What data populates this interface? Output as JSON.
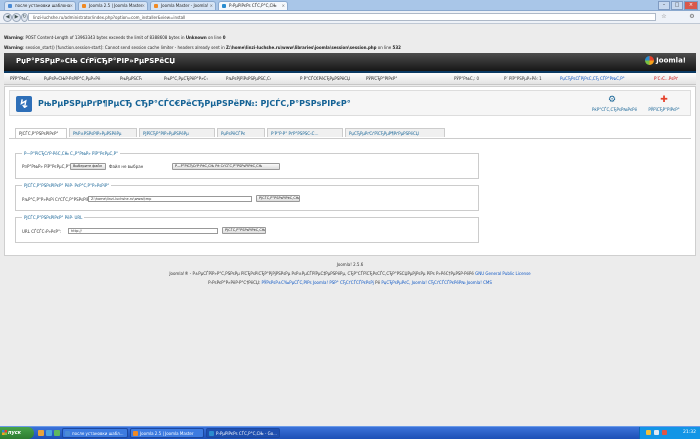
{
  "browser": {
    "tabs": [
      {
        "label": "после установки шаблона",
        "active": false,
        "color": "#4a8bd6"
      },
      {
        "label": "Joomla 2.5 | Joomla Master",
        "active": false,
        "color": "#f08a24"
      },
      {
        "label": "Joomla Master - Joomla!",
        "active": false,
        "color": "#f08a24"
      },
      {
        "label": "Р›РµРіРєРѕ СЃС‚Р°С‚СЊ",
        "active": true,
        "color": "#2a8ccf"
      }
    ],
    "url": "linzi-luchshe.ru/administrator/index.php?option=com_installer&view=install",
    "nav_back": "◀",
    "nav_fwd": "▶",
    "nav_reload": "↻"
  },
  "warnings": [
    {
      "label": "Warning",
      "text": ": POST Content-Length of 13963343 bytes exceeds the limit of 8388608 bytes in ",
      "bold2": "Unknown",
      "text2": " on line ",
      "bold3": "0"
    },
    {
      "label": "Warning",
      "text": ": session_start() [function.session-start]: Cannot send session cache limiter - headers already sent in ",
      "bold2": "Z:\\home\\linzi-luchshe.ru\\www\\libraries\\joomla\\session\\session.php",
      "text2": " on line ",
      "bold3": "532"
    }
  ],
  "header": {
    "site_name": "РџР°РЅРµР»СЊ СѓРїСЂР°РІР»РµРЅРёСЏ",
    "logo_text": "Joomla!"
  },
  "menu": {
    "items": [
      "РЎР°Р№С‚",
      "РџРѕР»СЊР·РѕРІР°С‚РµР»Рё",
      "РњРµРЅСЋ",
      "РњР°С‚РµСЂРёР°Р»С‹",
      "РљРѕРјРїРѕРЅРµРЅС‚С‹",
      "Р Р°СЃС€РёСЂРµРЅРёСЏ",
      "РЎРїСЂР°РІРєР°"
    ],
    "status": [
      "РџСЂРѕСЃРјРѕС‚СЂ",
      "0",
      "Р’С‹С…РѕРґ"
    ],
    "status_items": [
      {
        "text": "РЎР°Р№С‚: 0",
        "cls": ""
      },
      {
        "text": "Р’ РїР°РЅРµР»Рё: 1",
        "cls": ""
      },
      {
        "text": "РџСЂРѕСЃРјРѕС‚СЂ СЃР°Р№С‚Р°",
        "cls": "blue"
      },
      {
        "text": "Р’С‹С…РѕРґ",
        "cls": "red"
      }
    ]
  },
  "toolbar": {
    "title": "РњРµРЅРµРґР¶РµСЂ СЂР°СЃС€РёСЂРµРЅРёР№: РЈСЃС‚Р°РЅРѕРІРєР°",
    "options_label": "РќР°СЃС‚СЂРѕР№РєРё",
    "help_label": "РЎРїСЂР°РІРєР°"
  },
  "subtabs": [
    "РЈСЃС‚Р°РЅРѕРІРєР°",
    "РћР±РЅРѕРІР»РµРЅРёРµ",
    "РЈРїСЂР°РІР»РµРЅРёРµ",
    "РџРѕРёСЃРє",
    "Р‘Р°Р·Р° РґР°РЅРЅС‹С…",
    "РџСЂРµРґСѓРїСЂРµР¶РґРµРЅРёСЏ"
  ],
  "upload": {
    "legend": "Р—Р°РіСЂСѓР·РёС‚СЊ С„Р°Р№Р» РїР°РєРµС‚Р°",
    "label": "Р¤Р°Р№Р» РїР°РєРµС‚Р°:",
    "choose_button": "Выберите файл",
    "no_file": "Файл не выбран",
    "submit_button": "Р—Р°РіСЂСѓР·РёС‚СЊ Рё СѓСЃС‚Р°РЅРѕРІРёС‚СЊ"
  },
  "directory": {
    "legend": "РЈСЃС‚Р°РЅРѕРІРєР° РёР· РєР°С‚Р°Р»РѕРіР°",
    "label": "РљР°С‚Р°Р»РѕРі СѓСЃС‚Р°РЅРѕРІРєРё:",
    "value": "Z:\\home\\linzi-luchshe.ru\\www\\tmp",
    "button": "РЈСЃС‚Р°РЅРѕРІРёС‚СЊ"
  },
  "url_install": {
    "legend": "РЈСЃС‚Р°РЅРѕРІРєР° РёР· URL",
    "label": "URL СЃСЃС‹Р»РєР°:",
    "value": "http://",
    "button": "РЈСЃС‚Р°РЅРѕРІРёС‚СЊ"
  },
  "footer": {
    "version": "Joomla! 2.5.6",
    "line1_pre": "Joomla!® - ",
    "line1_mid": "Р±РµСЃРїР»Р°С‚РЅРѕРµ РїСЂРѕРіСЂР°РјРјРЅРѕРµ РѕР±РµСЃРїРµС‡РµРЅРёРµ, СЂР°СЃРїСЂРѕСЃС‚СЂР°РЅСЏРµРјРѕРµ РїРѕ Р»РёС†РµРЅР·РёРё ",
    "line1_link": "GNU General Public License",
    "line2_pre": "Р›РѕРєР°Р»РёР·Р°С†РёСЏ: ",
    "line2_link1": "РЎРѕРѕР±С‰РµСЃС‚РІРѕ Joomla! РЅР° СЂСѓСЃСЃРєРѕРј",
    "line2_mid": " Рё ",
    "line2_link2": "РџСЂРѕРµРєС‚ Joomla! СЂСѓСЃСЃРєРёР№ Joomla! CMS"
  },
  "taskbar": {
    "start_label": "пуск",
    "tasks": [
      {
        "label": "после установки шабл...",
        "color": "#4a8bd6"
      },
      {
        "label": "Joomla 2.5 | Joomla Master",
        "color": "#f08a24"
      },
      {
        "label": "Р›РµРіРєРѕ СЃС‚Р°С‚СЊ - Go...",
        "color": "#2a8ccf"
      }
    ],
    "clock": "21:32"
  },
  "colors": {
    "joomla_blue": "#146295",
    "link_blue": "#0b55c4",
    "logout_red": "#cc0000"
  }
}
